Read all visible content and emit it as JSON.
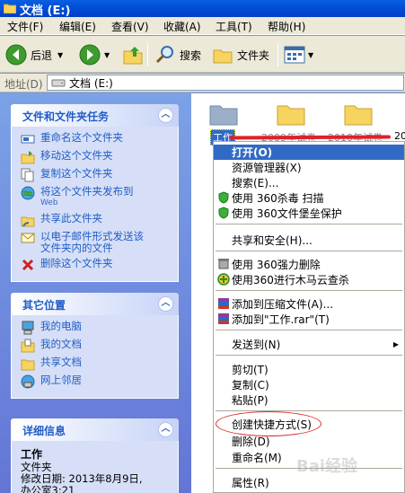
{
  "window": {
    "title": "文档 (E:)"
  },
  "menu": [
    "文件(F)",
    "编辑(E)",
    "查看(V)",
    "收藏(A)",
    "工具(T)",
    "帮助(H)"
  ],
  "toolbar": {
    "back_label": "后退",
    "search_label": "搜索",
    "folders_label": "文件夹"
  },
  "address": {
    "label": "地址(D)",
    "value": "文档 (E:)"
  },
  "left_pane": {
    "file_tasks": {
      "title": "文件和文件夹任务",
      "items": [
        {
          "label": "重命名这个文件夹",
          "icon": "rename-icon"
        },
        {
          "label": "移动这个文件夹",
          "icon": "move-icon"
        },
        {
          "label": "复制这个文件夹",
          "icon": "copy-icon"
        },
        {
          "label": "将这个文件夹发布到",
          "sub": "Web",
          "icon": "web-publish-icon"
        },
        {
          "label": "共享此文件夹",
          "icon": "share-icon"
        },
        {
          "label": "以电子邮件形式发送该",
          "sub": "文件夹内的文件",
          "icon": "email-icon"
        },
        {
          "label": "删除这个文件夹",
          "icon": "delete-icon"
        }
      ]
    },
    "other_places": {
      "title": "其它位置",
      "items": [
        {
          "label": "我的电脑",
          "icon": "my-computer-icon"
        },
        {
          "label": "我的文档",
          "icon": "my-documents-icon"
        },
        {
          "label": "共享文档",
          "icon": "shared-docs-icon"
        },
        {
          "label": "网上邻居",
          "icon": "network-icon"
        }
      ]
    },
    "details": {
      "title": "详细信息",
      "name": "工作",
      "type": "文件夹",
      "modified": "修改日期: 2013年8月9日,",
      "time": "办公室3:21"
    }
  },
  "content": {
    "folders": [
      {
        "label": "工作",
        "selected": true
      },
      {
        "label": "2009年试卷",
        "selected": false
      },
      {
        "label": "2010年试卷",
        "selected": false
      },
      {
        "label": "20",
        "selected": false
      }
    ]
  },
  "context_menu": {
    "items": [
      {
        "label": "打开(O)",
        "highlight": true
      },
      {
        "label": "资源管理器(X)"
      },
      {
        "label": "搜索(E)..."
      },
      {
        "label": "使用 360杀毒 扫描",
        "icon": "360-antivirus-icon"
      },
      {
        "label": "使用 360文件堡垒保护",
        "icon": "360-shield-icon"
      },
      {
        "label": "共享和安全(H)..."
      },
      {
        "label": "使用 360强力删除",
        "icon": "360-delete-icon"
      },
      {
        "label": "使用360进行木马云查杀",
        "icon": "360-trojan-icon"
      },
      {
        "label": "添加到压缩文件(A)...",
        "icon": "winrar-icon"
      },
      {
        "label": "添加到\"工作.rar\"(T)",
        "icon": "winrar-icon"
      },
      {
        "label": "发送到(N)",
        "submenu": true
      },
      {
        "label": "剪切(T)"
      },
      {
        "label": "复制(C)"
      },
      {
        "label": "粘贴(P)"
      },
      {
        "label": "创建快捷方式(S)",
        "circled": true
      },
      {
        "label": "删除(D)"
      },
      {
        "label": "重命名(M)"
      },
      {
        "label": "属性(R)"
      }
    ]
  },
  "watermark": "Bai经验",
  "colors": {
    "accent": "#316ac5",
    "annotation": "#d92b2b"
  }
}
